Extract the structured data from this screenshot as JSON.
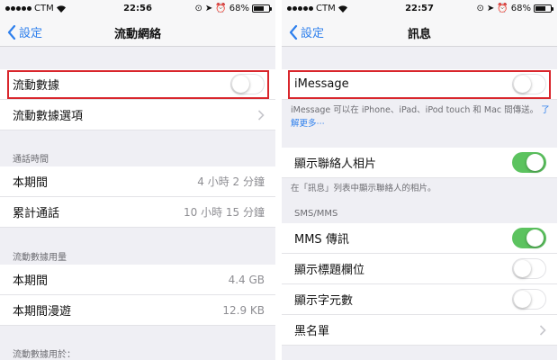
{
  "left": {
    "statusbar": {
      "carrier": "CTM",
      "time": "22:56",
      "battery": "68%",
      "battery_level": 0.68
    },
    "nav": {
      "back_label": "設定",
      "title": "流動網絡"
    },
    "cellular_data": {
      "label": "流動數據",
      "on": false
    },
    "cellular_options": {
      "label": "流動數據選項"
    },
    "call_time": {
      "header": "通話時間",
      "current_period": {
        "label": "本期間",
        "value": "4 小時 2 分鐘"
      },
      "lifetime": {
        "label": "累計通話",
        "value": "10 小時 15 分鐘"
      }
    },
    "data_usage": {
      "header": "流動數據用量",
      "current_period": {
        "label": "本期間",
        "value": "4.4 GB"
      },
      "roaming": {
        "label": "本期間漫遊",
        "value": "12.9 KB"
      }
    },
    "use_for_header": "流動數據用於："
  },
  "right": {
    "statusbar": {
      "carrier": "CTM",
      "time": "22:57",
      "battery": "68%",
      "battery_level": 0.68
    },
    "nav": {
      "back_label": "設定",
      "title": "訊息"
    },
    "imessage": {
      "label": "iMessage",
      "on": false,
      "footnote": "iMessage 可以在 iPhone、iPad、iPod touch 和 Mac 間傳送。",
      "learn_more": "了解更多⋯"
    },
    "contact_photos": {
      "label": "顯示聯絡人相片",
      "on": true,
      "footnote": "在「訊息」列表中顯示聯絡人的相片。"
    },
    "sms_header": "SMS/MMS",
    "mms": {
      "label": "MMS 傳訊",
      "on": true
    },
    "subject_field": {
      "label": "顯示標題欄位",
      "on": false
    },
    "char_count": {
      "label": "顯示字元數",
      "on": false
    },
    "blocked": {
      "label": "黑名單"
    }
  },
  "colors": {
    "accent": "#2f80ed",
    "toggle_on": "#5cc35f",
    "highlight": "#d9262c"
  },
  "icons": [
    "back-chevron-icon",
    "chevron-right-icon",
    "wifi-icon",
    "location-icon",
    "alarm-icon",
    "lock-rotation-icon",
    "battery-icon"
  ]
}
